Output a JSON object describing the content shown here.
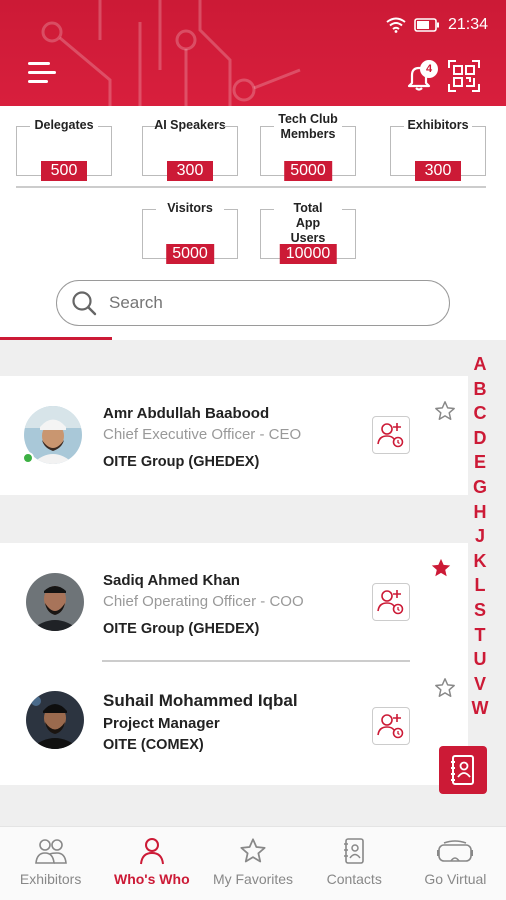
{
  "status_bar": {
    "time": "21:34"
  },
  "header": {
    "notification_count": "4"
  },
  "stats": [
    {
      "label": "Delegates",
      "value": "500"
    },
    {
      "label": "AI Speakers",
      "value": "300"
    },
    {
      "label": "Tech Club Members",
      "value": "5000"
    },
    {
      "label": "Exhibitors",
      "value": "300"
    },
    {
      "label": "Visitors",
      "value": "5000"
    },
    {
      "label": "Total App Users",
      "value": "10000"
    }
  ],
  "search": {
    "placeholder": "Search"
  },
  "people": [
    {
      "name": "Amr Abdullah Baabood",
      "title": "Chief Executive Officer - CEO",
      "org": "OITE Group (GHEDEX)",
      "online": true,
      "favorite": false
    },
    {
      "name": "Sadiq Ahmed Khan",
      "title": "Chief Operating Officer - COO",
      "org": "OITE Group (GHEDEX)",
      "online": false,
      "favorite": true
    },
    {
      "name": "Suhail Mohammed Iqbal",
      "title": "Project Manager",
      "org": "OITE (COMEX)",
      "online": false,
      "favorite": false
    }
  ],
  "alphabet": [
    "A",
    "B",
    "C",
    "D",
    "E",
    "G",
    "H",
    "J",
    "K",
    "L",
    "S",
    "T",
    "U",
    "V",
    "W"
  ],
  "bottom_nav": [
    {
      "label": "Exhibitors",
      "icon": "people-icon",
      "active": false
    },
    {
      "label": "Who's Who",
      "icon": "person-icon",
      "active": true
    },
    {
      "label": "My Favorites",
      "icon": "star-icon",
      "active": false
    },
    {
      "label": "Contacts",
      "icon": "contact-book-icon",
      "active": false
    },
    {
      "label": "Go Virtual",
      "icon": "vr-headset-icon",
      "active": false
    }
  ],
  "colors": {
    "accent": "#cc1a36",
    "online": "#3cb043",
    "background": "#efefef"
  }
}
